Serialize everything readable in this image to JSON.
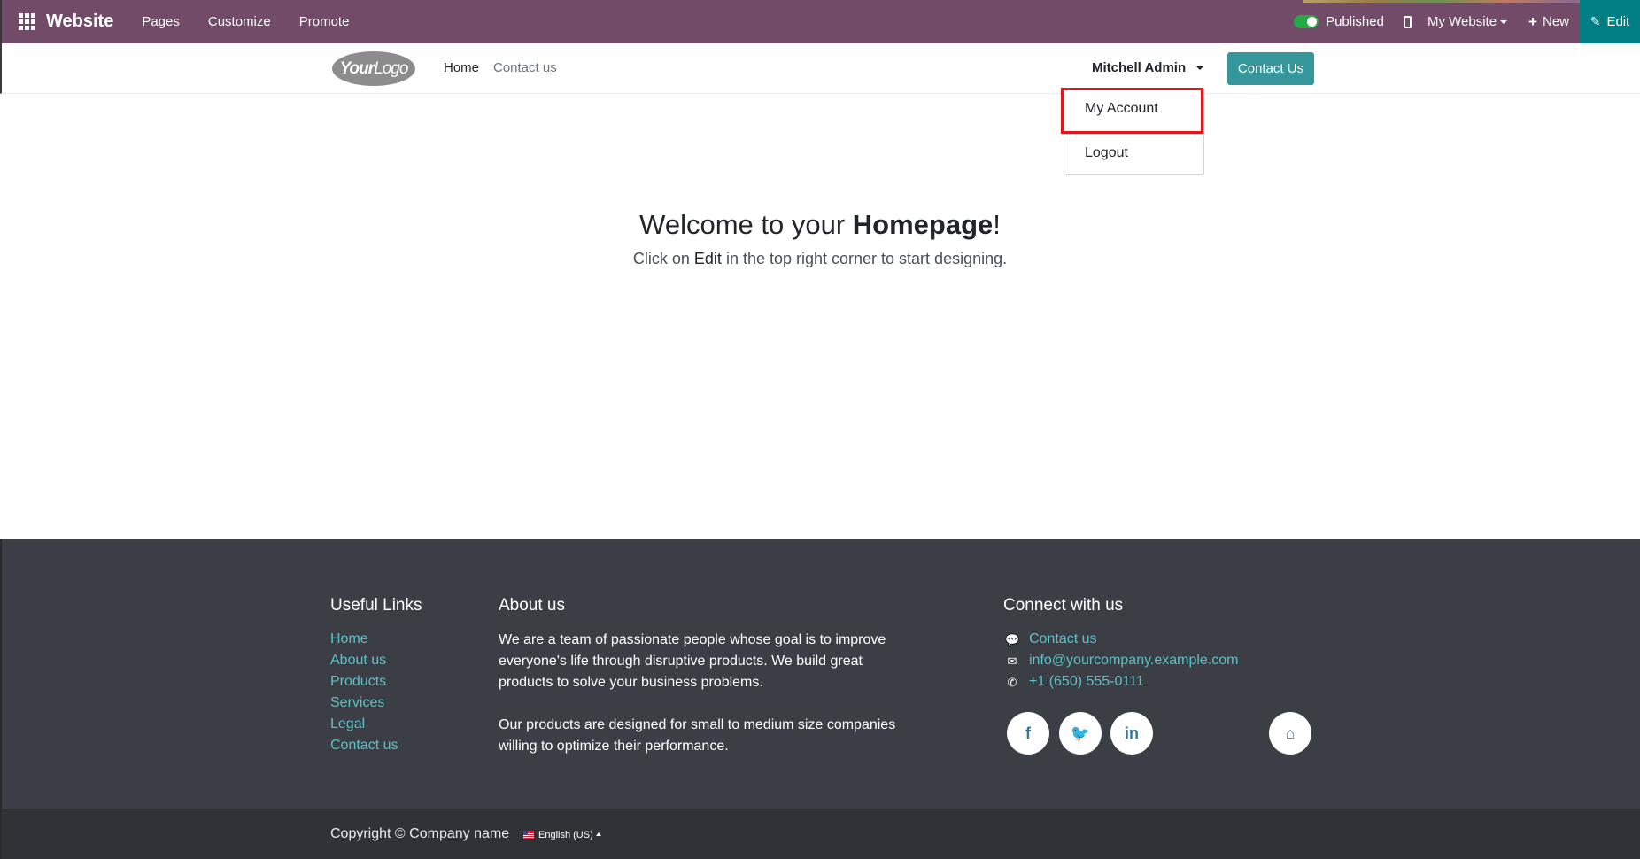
{
  "topbar": {
    "brand": "Website",
    "menu": [
      "Pages",
      "Customize",
      "Promote"
    ],
    "published_label": "Published",
    "my_website_label": "My Website",
    "new_label": "New",
    "edit_label": "Edit",
    "bg_color": "#714b67",
    "edit_color": "#017e84"
  },
  "header": {
    "logo_text_bold": "Your",
    "logo_text": "Logo",
    "nav": [
      "Home",
      "Contact us"
    ],
    "user_name": "Mitchell Admin",
    "contact_button": "Contact Us",
    "accent_color": "#35979c"
  },
  "dropdown": {
    "items": [
      "My Account",
      "Logout"
    ],
    "highlighted": "My Account",
    "highlight_color": "#e5131c"
  },
  "main": {
    "welcome_prefix": "Welcome to your ",
    "welcome_bold": "Homepage",
    "welcome_suffix": "!",
    "sub_prefix": "Click on ",
    "sub_bold": "Edit",
    "sub_suffix": " in the top right corner to start designing."
  },
  "footer": {
    "useful_links_title": "Useful Links",
    "useful_links": [
      "Home",
      "About us",
      "Products",
      "Services",
      "Legal",
      "Contact us"
    ],
    "about_title": "About us",
    "about_p1": "We are a team of passionate people whose goal is to improve everyone's life through disruptive products. We build great products to solve your business problems.",
    "about_p2": "Our products are designed for small to medium size companies willing to optimize their performance.",
    "connect_title": "Connect with us",
    "contact_items": [
      {
        "icon": "comment-icon",
        "text": "Contact us"
      },
      {
        "icon": "envelope-icon",
        "text": "info@yourcompany.example.com"
      },
      {
        "icon": "phone-icon",
        "text": "+1 (650) 555-0111"
      }
    ],
    "social": [
      {
        "icon": "facebook-icon",
        "glyph": "f"
      },
      {
        "icon": "twitter-icon",
        "glyph": "🐦"
      },
      {
        "icon": "linkedin-icon",
        "glyph": "in"
      },
      {
        "icon": "home-icon",
        "glyph": "⌂"
      }
    ],
    "link_color": "#5bc0c7"
  },
  "copyright": {
    "text": "Copyright © Company name",
    "language": "English (US)"
  }
}
